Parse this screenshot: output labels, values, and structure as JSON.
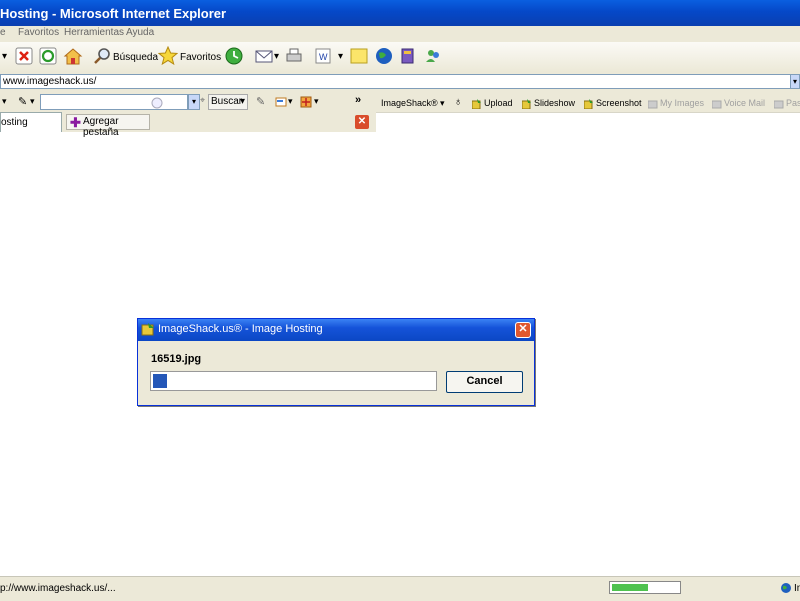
{
  "window": {
    "title": "Hosting - Microsoft Internet Explorer"
  },
  "menu": [
    "e",
    "Favoritos",
    "Herramientas",
    "Ayuda"
  ],
  "toolbar": {
    "search_label": "Búsqueda",
    "favorites_label": "Favoritos"
  },
  "address": {
    "value": "www.imageshack.us/"
  },
  "search": {
    "button_label": "Buscar",
    "chevron": "»"
  },
  "imageshack": {
    "brand": "ImageShack®",
    "items": [
      {
        "label": "Upload",
        "enabled": true
      },
      {
        "label": "Slideshow",
        "enabled": true
      },
      {
        "label": "Screenshot",
        "enabled": true
      },
      {
        "label": "My Images",
        "enabled": false
      },
      {
        "label": "Voice Mail",
        "enabled": false
      },
      {
        "label": "Past",
        "enabled": false
      }
    ]
  },
  "tabs": {
    "active_label": "osting",
    "add_label": "Agregar pestaña"
  },
  "status": {
    "text": "p://www.imageshack.us/...",
    "progress": 0.55,
    "zone": "In"
  },
  "dialog": {
    "title": "ImageShack.us® - Image Hosting",
    "filename": "16519.jpg",
    "progress": 0.05,
    "cancel_label": "Cancel"
  },
  "colors": {
    "accent": "#0a4fd6",
    "dialog_progress": "#2457b8",
    "status_progress": "#4fc24f"
  }
}
